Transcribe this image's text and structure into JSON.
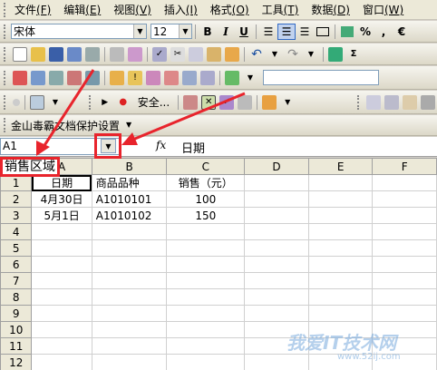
{
  "menu": [
    {
      "label": "文件",
      "acc": "(F)"
    },
    {
      "label": "编辑",
      "acc": "(E)"
    },
    {
      "label": "视图",
      "acc": "(V)"
    },
    {
      "label": "插入",
      "acc": "(I)"
    },
    {
      "label": "格式",
      "acc": "(O)"
    },
    {
      "label": "工具",
      "acc": "(T)"
    },
    {
      "label": "数据",
      "acc": "(D)"
    },
    {
      "label": "窗口",
      "acc": "(W)"
    }
  ],
  "format_toolbar": {
    "font": "宋体",
    "size": "12",
    "bold": "B",
    "italic": "I",
    "underline": "U",
    "percent": "%",
    "comma": ",",
    "euro": "€"
  },
  "toolbar4": {
    "security_label": "安全..."
  },
  "addin_bar": {
    "label": "金山毒霸文档保护设置"
  },
  "name_box": {
    "value": "A1",
    "fx": "fx",
    "formula": "日期"
  },
  "annotation": {
    "label": "销售区域"
  },
  "sheet": {
    "columns": [
      "A",
      "B",
      "C",
      "D",
      "E",
      "F"
    ],
    "rows": [
      {
        "n": "1",
        "cells": [
          "日期",
          "商品品种",
          "销售（元）",
          "",
          "",
          ""
        ]
      },
      {
        "n": "2",
        "cells": [
          "4月30日",
          "A1010101",
          "100",
          "",
          "",
          ""
        ]
      },
      {
        "n": "3",
        "cells": [
          "5月1日",
          "A1010102",
          "150",
          "",
          "",
          ""
        ]
      },
      {
        "n": "4",
        "cells": [
          "",
          "",
          "",
          "",
          "",
          ""
        ]
      },
      {
        "n": "5",
        "cells": [
          "",
          "",
          "",
          "",
          "",
          ""
        ]
      },
      {
        "n": "6",
        "cells": [
          "",
          "",
          "",
          "",
          "",
          ""
        ]
      },
      {
        "n": "7",
        "cells": [
          "",
          "",
          "",
          "",
          "",
          ""
        ]
      },
      {
        "n": "8",
        "cells": [
          "",
          "",
          "",
          "",
          "",
          ""
        ]
      },
      {
        "n": "9",
        "cells": [
          "",
          "",
          "",
          "",
          "",
          ""
        ]
      },
      {
        "n": "10",
        "cells": [
          "",
          "",
          "",
          "",
          "",
          ""
        ]
      },
      {
        "n": "11",
        "cells": [
          "",
          "",
          "",
          "",
          "",
          ""
        ]
      },
      {
        "n": "12",
        "cells": [
          "",
          "",
          "",
          "",
          "",
          ""
        ]
      }
    ]
  },
  "watermark": {
    "text": "我爱IT技术网",
    "url": "www.52ij.com"
  },
  "colors": {
    "annotation": "#e8242c",
    "chrome": "#ece9d8"
  }
}
